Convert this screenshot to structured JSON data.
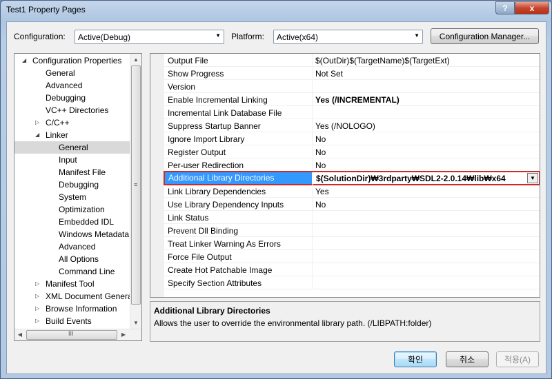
{
  "window": {
    "title": "Test1 Property Pages",
    "help_label": "?",
    "close_label": "x"
  },
  "toolbar": {
    "configuration_label": "Configuration:",
    "configuration_value": "Active(Debug)",
    "platform_label": "Platform:",
    "platform_value": "Active(x64)",
    "config_manager_label": "Configuration Manager..."
  },
  "tree": {
    "items": [
      {
        "label": "Configuration Properties",
        "expander": "◢"
      },
      {
        "label": "General",
        "expander": ""
      },
      {
        "label": "Advanced",
        "expander": ""
      },
      {
        "label": "Debugging",
        "expander": ""
      },
      {
        "label": "VC++ Directories",
        "expander": ""
      },
      {
        "label": "C/C++",
        "expander": "▷"
      },
      {
        "label": "Linker",
        "expander": "◢"
      },
      {
        "label": "General",
        "expander": ""
      },
      {
        "label": "Input",
        "expander": ""
      },
      {
        "label": "Manifest File",
        "expander": ""
      },
      {
        "label": "Debugging",
        "expander": ""
      },
      {
        "label": "System",
        "expander": ""
      },
      {
        "label": "Optimization",
        "expander": ""
      },
      {
        "label": "Embedded IDL",
        "expander": ""
      },
      {
        "label": "Windows Metadata",
        "expander": ""
      },
      {
        "label": "Advanced",
        "expander": ""
      },
      {
        "label": "All Options",
        "expander": ""
      },
      {
        "label": "Command Line",
        "expander": ""
      },
      {
        "label": "Manifest Tool",
        "expander": "▷"
      },
      {
        "label": "XML Document Generator",
        "expander": "▷"
      },
      {
        "label": "Browse Information",
        "expander": "▷"
      },
      {
        "label": "Build Events",
        "expander": "▷"
      }
    ],
    "scroll_up": "▲",
    "scroll_down": "▼",
    "scroll_left": "◀",
    "scroll_right": "▶",
    "grip_v": "≡",
    "grip_h": "III"
  },
  "properties": [
    {
      "name": "Output File",
      "value": "$(OutDir)$(TargetName)$(TargetExt)"
    },
    {
      "name": "Show Progress",
      "value": "Not Set"
    },
    {
      "name": "Version",
      "value": ""
    },
    {
      "name": "Enable Incremental Linking",
      "value": "Yes (/INCREMENTAL)"
    },
    {
      "name": "Incremental Link Database File",
      "value": ""
    },
    {
      "name": "Suppress Startup Banner",
      "value": "Yes (/NOLOGO)"
    },
    {
      "name": "Ignore Import Library",
      "value": "No"
    },
    {
      "name": "Register Output",
      "value": "No"
    },
    {
      "name": "Per-user Redirection",
      "value": "No"
    },
    {
      "name": "Additional Library Directories",
      "value": "$(SolutionDir)₩3rdparty₩SDL2-2.0.14₩lib₩x64"
    },
    {
      "name": "Link Library Dependencies",
      "value": "Yes"
    },
    {
      "name": "Use Library Dependency Inputs",
      "value": "No"
    },
    {
      "name": "Link Status",
      "value": ""
    },
    {
      "name": "Prevent Dll Binding",
      "value": ""
    },
    {
      "name": "Treat Linker Warning As Errors",
      "value": ""
    },
    {
      "name": "Force File Output",
      "value": ""
    },
    {
      "name": "Create Hot Patchable Image",
      "value": ""
    },
    {
      "name": "Specify Section Attributes",
      "value": ""
    }
  ],
  "dropdown_glyph": "▼",
  "description": {
    "title": "Additional Library Directories",
    "text": "Allows the user to override the environmental library path. (/LIBPATH:folder)"
  },
  "buttons": {
    "ok": "확인",
    "cancel": "취소",
    "apply": "적용(A)"
  },
  "colors": {
    "selection": "#3399ff",
    "highlight_border": "#cc2a2a",
    "tree_selection": "#d9d9d9"
  }
}
